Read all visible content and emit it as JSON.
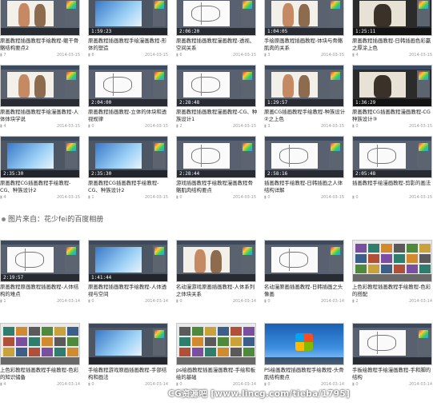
{
  "caption": "图片来自：花少fei的百度相册",
  "watermark": "CG资源吧 [www.lincg.com/tieba/1795]",
  "top_grid": [
    {
      "time": "",
      "title": "原画教程插画教程手绘教程-躯干骨骼结构要点2",
      "count": "7",
      "date": "2014-03-15",
      "scene": "figure"
    },
    {
      "time": "1:59:23",
      "title": "原画教程插画教程手绘漫画教程-形体的塑造",
      "count": "8",
      "date": "2014-03-15",
      "scene": "blue"
    },
    {
      "time": "2:06:20",
      "title": "原画教程插画教程漫画教程-透视、空间关系",
      "count": "6",
      "date": "2014-03-15",
      "scene": "sketch"
    },
    {
      "time": "1:04:05",
      "title": "手绘原画教程插画教程-体块与骨骼肌肉的关系",
      "count": "3",
      "date": "2014-03-15",
      "scene": "figure"
    },
    {
      "time": "1:25:11",
      "title": "原画教程插画教程-日韩插画色彩赢之厚涂上色",
      "count": "4",
      "date": "2014-03-15",
      "scene": "dark"
    },
    {
      "time": "",
      "title": "原画教程插画教程手绘漫画教程-人体体块学说",
      "count": "4",
      "date": "2014-03-15",
      "scene": "figure"
    },
    {
      "time": "2:04:00",
      "title": "原画教程插画教程-立体的体块和透视规律",
      "count": "0",
      "date": "2014-03-15",
      "scene": "sketch"
    },
    {
      "time": "2:28:48",
      "title": "原画教程插画教程漫画教程-CG、种族设计1",
      "count": "2",
      "date": "2014-03-15",
      "scene": "sketch"
    },
    {
      "time": "1:29:57",
      "title": "原画CG插画教程手绘教程-种族设计②之上色",
      "count": "3",
      "date": "2014-03-15",
      "scene": "figure"
    },
    {
      "time": "1:36:29",
      "title": "原画教程CG插画教程漫画教程-CG种族设计③",
      "count": "0",
      "date": "2014-03-15",
      "scene": "dark"
    },
    {
      "time": "2:35:30",
      "title": "原画教程CG插画教程手绘教程-CG、种族设计2",
      "count": "4",
      "date": "2014-03-15",
      "scene": "blue"
    },
    {
      "time": "2:35:30",
      "title": "原画教程CG插画教程手绘教程-CG、种族设计2",
      "count": "1",
      "date": "2014-03-15",
      "scene": "blue"
    },
    {
      "time": "2:28:44",
      "title": "游戏插画教程手绘教程漫画教程骨骼肌肉结构要点",
      "count": "0",
      "date": "2014-03-15",
      "scene": "sketch"
    },
    {
      "time": "2:58:16",
      "title": "插画教程手绘教程-日韩插画之人体结构详解",
      "count": "0",
      "date": "2014-03-15",
      "scene": "sketch"
    },
    {
      "time": "2:05:48",
      "title": "插画教程手绘漫画教程-剪影的画法",
      "count": "0",
      "date": "2014-03-15",
      "scene": "sketch"
    }
  ],
  "bottom_grid": [
    {
      "time": "2:19:57",
      "title": "原画教程原画教程插画教程-人体结构的难点",
      "count": "1",
      "date": "2014-03-14",
      "scene": "sketch"
    },
    {
      "time": "1:41:44",
      "title": "原画教程插画教程手绘教程-人体透视与空间",
      "count": "0",
      "date": "2014-03-14",
      "scene": "blue"
    },
    {
      "time": "",
      "title": "名动漫游戏原画插画教程-人体系列之体块关系",
      "count": "0",
      "date": "2014-03-14",
      "scene": "figure"
    },
    {
      "time": "",
      "title": "名动漫原画插画教程-日韩插画之头像画",
      "count": "0",
      "date": "2014-03-14",
      "scene": "sketch"
    },
    {
      "time": "",
      "title": "上色彩教程插画教程手绘教程-色彩的搭配",
      "count": "2",
      "date": "2014-03-14",
      "scene": "photos"
    },
    {
      "time": "",
      "title": "上色彩教程插画教程手绘教程-色彩的知识储备",
      "count": "4",
      "date": "2014-03-14",
      "scene": "photos"
    },
    {
      "time": "",
      "title": "手绘教程游戏原画插画教程-手部结构和画法",
      "count": "0",
      "date": "2014-03-14",
      "scene": "blue"
    },
    {
      "time": "",
      "title": "ps绘画教程插画漫画教程-手绘和板绘的基础",
      "count": "0",
      "date": "2014-03-14",
      "scene": "photos"
    },
    {
      "time": "",
      "title": "PS绘画教程插画教程手绘教程-头骨肌结构要点",
      "count": "0",
      "date": "2014-03-14",
      "scene": "windows"
    },
    {
      "time": "",
      "title": "手板绘教程手绘漫画教程-手和脚的结构",
      "count": "0",
      "date": "2014-03-14",
      "scene": "sketch"
    }
  ]
}
